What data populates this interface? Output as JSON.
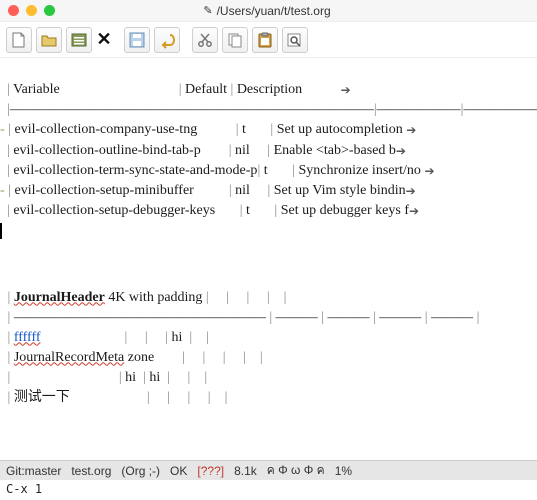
{
  "window": {
    "path": "/Users/yuan/t/test.org",
    "modified_glyph": "✎"
  },
  "toolbar": {
    "new": "new-file",
    "open": "open-file",
    "dired": "dired",
    "kill": "kill-buffer",
    "save": "save-file",
    "undo": "undo",
    "cut": "cut",
    "copy": "copy",
    "paste": "paste",
    "search": "search"
  },
  "table1": {
    "headers": {
      "variable": "Variable",
      "default": "Default",
      "description": "Description"
    },
    "rows": [
      {
        "changed": "-",
        "var": "evil-collection-company-use-tng",
        "def": "t",
        "desc": "Set up autocompletion"
      },
      {
        "changed": " ",
        "var": "evil-collection-outline-bind-tab-p",
        "def": "nil",
        "desc": "Enable <tab>-based b"
      },
      {
        "changed": " ",
        "var": "evil-collection-term-sync-state-and-mode-p",
        "def": "t",
        "desc": "Synchronize insert/no"
      },
      {
        "changed": "-",
        "var": "evil-collection-setup-minibuffer",
        "def": "nil",
        "desc": "Set up Vim style bindin"
      },
      {
        "changed": " ",
        "var": "evil-collection-setup-debugger-keys",
        "def": "t",
        "desc": "Set up debugger keys f"
      }
    ]
  },
  "table2": {
    "r1": {
      "a": "JournalHeader",
      "b": "4K with padding"
    },
    "r2": {
      "a": "ffffff",
      "e": "hi"
    },
    "r3": {
      "a": "JournalRecordMeta",
      "b": "zone"
    },
    "r4": {
      "c": "hi",
      "d": "hi"
    },
    "r5": {
      "a": "测试一下"
    }
  },
  "modeline": {
    "git": "Git:master",
    "file": "test.org",
    "mode": "(Org ;-)",
    "ok": "OK",
    "qqq": "[???]",
    "size": "8.1k",
    "glyphs": "ค Φ ω Φ ค",
    "pct": "1%"
  },
  "minibuffer": {
    "echo": "C-x 1"
  }
}
